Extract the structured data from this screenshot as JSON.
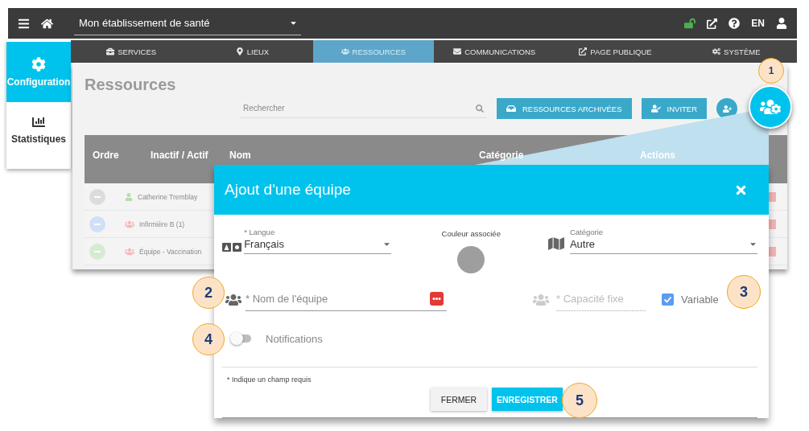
{
  "top_bar": {
    "facility": "Mon établissement de santé",
    "language": "EN"
  },
  "sidebar": {
    "items": [
      {
        "label": "Configuration",
        "selected": true
      },
      {
        "label": "Statistiques",
        "selected": false
      }
    ]
  },
  "tabs": [
    {
      "label": "SERVICES",
      "selected": false
    },
    {
      "label": "LIEUX",
      "selected": false
    },
    {
      "label": "RESSOURCES",
      "selected": true
    },
    {
      "label": "COMMUNICATIONS",
      "selected": false
    },
    {
      "label": "PAGE PUBLIQUE",
      "selected": false
    },
    {
      "label": "SYSTÈME",
      "selected": false
    }
  ],
  "page": {
    "title": "Ressources",
    "search": {
      "placeholder": "Rechercher"
    },
    "buttons": [
      "RESSOURCES ARCHIVÉES",
      "INVITER"
    ],
    "table": {
      "columns": [
        "Ordre",
        "Inactif / Actif",
        "Nom",
        "Catégorie",
        "Actions"
      ],
      "rows": [
        {
          "name": "Catherine Tremblay",
          "kind": "person",
          "color": "#dcdcdc"
        },
        {
          "name": "Infirmière B (1)",
          "kind": "group",
          "color": "#cfe0f7"
        },
        {
          "name": "Équipe - Vaccination",
          "kind": "group",
          "color": "#d7ead3"
        }
      ]
    }
  },
  "dialog": {
    "title": "Ajout d'une équipe",
    "language": {
      "label": "* Langue",
      "value": "Français"
    },
    "color": {
      "label": "Couleur associée",
      "color": "#9e9e9e"
    },
    "category": {
      "label": "Catégorie",
      "value": "Autre"
    },
    "team_name": {
      "placeholder": "* Nom de l'équipe"
    },
    "capacity": {
      "placeholder": "* Capacité fixe",
      "disabled": true
    },
    "variable": {
      "label": "Variable",
      "checked": true
    },
    "notifications": {
      "label": "Notifications",
      "on": false
    },
    "footnote": "* Indique un champ requis",
    "buttons": [
      {
        "label": "FERMER",
        "kind": "secondary"
      },
      {
        "label": "ENREGISTRER",
        "kind": "primary"
      }
    ]
  },
  "callouts": [
    "1",
    "2",
    "3",
    "4",
    "5"
  ]
}
